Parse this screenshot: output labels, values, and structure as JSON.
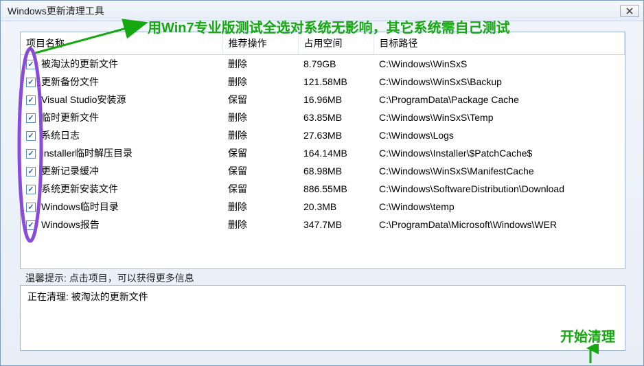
{
  "window": {
    "title": "Windows更新清理工具"
  },
  "annotations": {
    "top": "用Win7专业版测试全选对系统无影响，其它系统需自己测试",
    "bottom": "开始清理"
  },
  "table": {
    "headers": {
      "name": "项目名称",
      "action": "推荐操作",
      "size": "占用空间",
      "path": "目标路径"
    },
    "rows": [
      {
        "checked": true,
        "name": "被淘汰的更新文件",
        "action": "删除",
        "size": "8.79GB",
        "path": "C:\\Windows\\WinSxS"
      },
      {
        "checked": true,
        "name": "更新备份文件",
        "action": "删除",
        "size": "121.58MB",
        "path": "C:\\Windows\\WinSxS\\Backup"
      },
      {
        "checked": true,
        "name": "Visual Studio安装源",
        "action": "保留",
        "size": "16.96MB",
        "path": "C:\\ProgramData\\Package Cache"
      },
      {
        "checked": true,
        "name": "临时更新文件",
        "action": "删除",
        "size": "63.85MB",
        "path": "C:\\Windows\\WinSxS\\Temp"
      },
      {
        "checked": true,
        "name": "系统日志",
        "action": "删除",
        "size": "27.63MB",
        "path": "C:\\Windows\\Logs"
      },
      {
        "checked": true,
        "name": "Installer临时解压目录",
        "action": "保留",
        "size": "164.14MB",
        "path": "C:\\Windows\\Installer\\$PatchCache$"
      },
      {
        "checked": true,
        "name": "更新记录缓冲",
        "action": "保留",
        "size": "68.98MB",
        "path": "C:\\Windows\\WinSxS\\ManifestCache"
      },
      {
        "checked": true,
        "name": "系统更新安装文件",
        "action": "保留",
        "size": "886.55MB",
        "path": "C:\\Windows\\SoftwareDistribution\\Download"
      },
      {
        "checked": true,
        "name": "Windows临时目录",
        "action": "删除",
        "size": "20.3MB",
        "path": "C:\\Windows\\temp"
      },
      {
        "checked": true,
        "name": "Windows报告",
        "action": "删除",
        "size": "347.7MB",
        "path": "C:\\ProgramData\\Microsoft\\Windows\\WER"
      }
    ]
  },
  "hint": "温馨提示: 点击项目，可以获得更多信息",
  "status": "正在清理: 被淘汰的更新文件"
}
